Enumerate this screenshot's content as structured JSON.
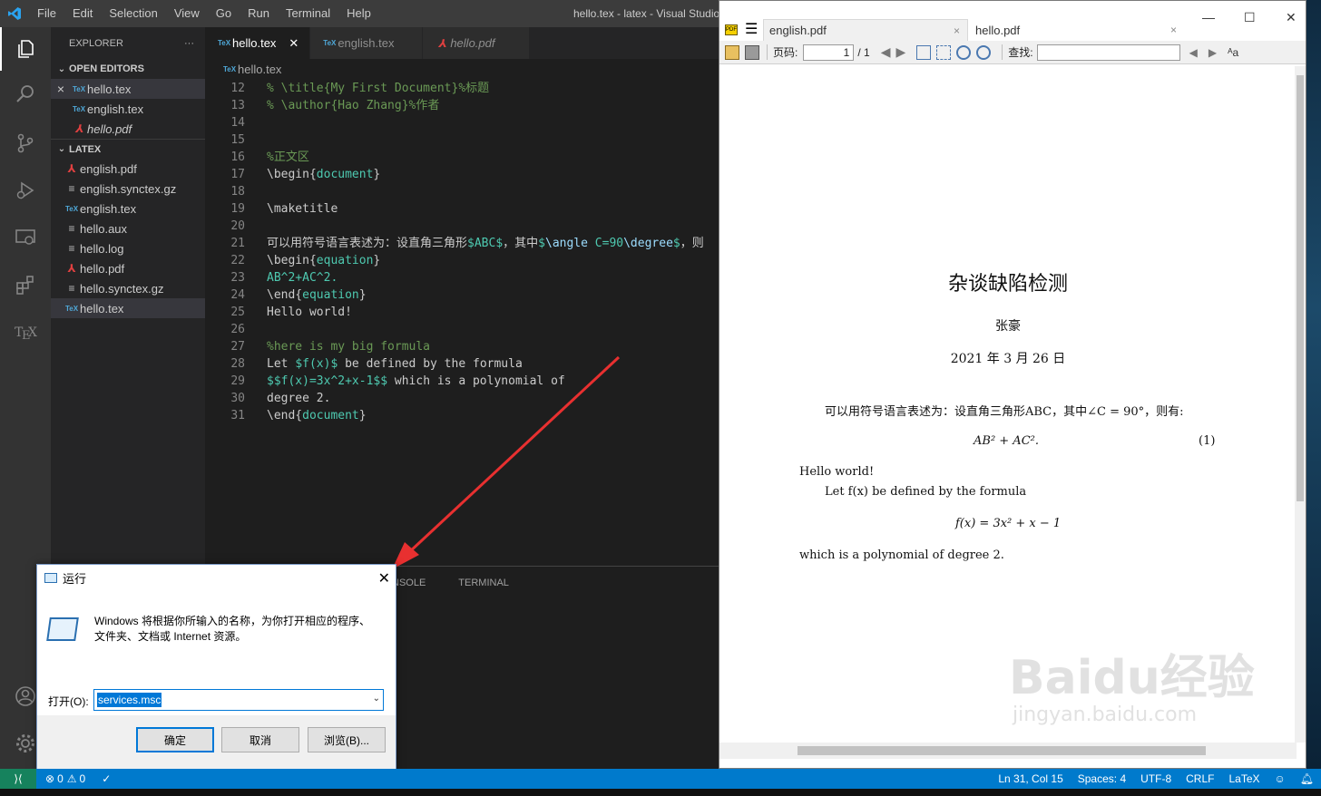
{
  "vscode": {
    "window_title": "hello.tex - latex - Visual Studio Code",
    "menu": [
      "File",
      "Edit",
      "Selection",
      "View",
      "Go",
      "Run",
      "Terminal",
      "Help"
    ],
    "explorer": {
      "header": "EXPLORER",
      "more": "···",
      "open_editors_title": "OPEN EDITORS",
      "open_editors": [
        {
          "name": "hello.tex",
          "type": "tex"
        },
        {
          "name": "english.tex",
          "type": "tex"
        },
        {
          "name": "hello.pdf",
          "type": "pdf"
        }
      ],
      "folder_title": "LATEX",
      "files": [
        {
          "name": "english.pdf",
          "type": "pdf"
        },
        {
          "name": "english.synctex.gz",
          "type": "txt"
        },
        {
          "name": "english.tex",
          "type": "tex"
        },
        {
          "name": "hello.aux",
          "type": "txt"
        },
        {
          "name": "hello.log",
          "type": "txt"
        },
        {
          "name": "hello.pdf",
          "type": "pdf"
        },
        {
          "name": "hello.synctex.gz",
          "type": "txt"
        },
        {
          "name": "hello.tex",
          "type": "tex"
        }
      ]
    },
    "tabs": [
      {
        "label": "hello.tex",
        "active": true
      },
      {
        "label": "english.tex",
        "active": false
      },
      {
        "label": "hello.pdf",
        "active": false
      }
    ],
    "breadcrumb": "hello.tex",
    "code_lines": [
      {
        "n": "12",
        "text": "% \\title{My First Document}%标题"
      },
      {
        "n": "13",
        "text": "% \\author{Hao Zhang}%作者"
      },
      {
        "n": "14",
        "text": ""
      },
      {
        "n": "15",
        "text": ""
      },
      {
        "n": "16",
        "text": "%正文区"
      },
      {
        "n": "17",
        "text": "\\begin{document}"
      },
      {
        "n": "18",
        "text": ""
      },
      {
        "n": "19",
        "text": "\\maketitle"
      },
      {
        "n": "20",
        "text": ""
      },
      {
        "n": "21",
        "text": "可以用符号语言表述为：设直角三角形$ABC$，其中$\\angle C=90\\degree$，则"
      },
      {
        "n": "22",
        "text": "\\begin{equation}"
      },
      {
        "n": "23",
        "text": "AB^2+AC^2."
      },
      {
        "n": "24",
        "text": "\\end{equation}"
      },
      {
        "n": "25",
        "text": "Hello world!"
      },
      {
        "n": "26",
        "text": ""
      },
      {
        "n": "27",
        "text": "%here is my big formula"
      },
      {
        "n": "28",
        "text": "Let $f(x)$ be defined by the formula"
      },
      {
        "n": "29",
        "text": "$$f(x)=3x^2+x-1$$ which is a polynomial of"
      },
      {
        "n": "30",
        "text": "degree 2."
      },
      {
        "n": "31",
        "text": "\\end{document}"
      }
    ],
    "panel_tabs": [
      "NSOLE",
      "TERMINAL"
    ],
    "status": {
      "errors": "0",
      "warnings": "0",
      "position": "Ln 31, Col 15",
      "spaces": "Spaces: 4",
      "encoding": "UTF-8",
      "eol": "CRLF",
      "language": "LaTeX"
    }
  },
  "pdf_viewer": {
    "tabs": [
      {
        "label": "english.pdf",
        "close": "×"
      },
      {
        "label": "hello.pdf",
        "close": "×"
      }
    ],
    "page_label": "页码:",
    "page_current": "1",
    "page_total": "/ 1",
    "find_label": "查找:",
    "document": {
      "title": "杂谈缺陷检测",
      "author": "张豪",
      "date": "2021 年 3 月 26 日",
      "para1": "可以用符号语言表述为：设直角三角形ABC，其中∠C = 90°，则有:",
      "equation": "AB² + AC².",
      "eq_number": "(1)",
      "hello": "Hello world!",
      "let_line": "Let f(x) be defined by the formula",
      "formula": "f(x) = 3x² + x − 1",
      "last_line": "which is a polynomial of degree 2."
    }
  },
  "run_dialog": {
    "title": "运行",
    "description_line1": "Windows 将根据你所输入的名称，为你打开相应的程序、",
    "description_line2": "文件夹、文档或 Internet 资源。",
    "open_label": "打开(O):",
    "input_value": "services.msc",
    "ok": "确定",
    "cancel": "取消",
    "browse": "浏览(B)..."
  },
  "watermark": {
    "text": "Baidu经验",
    "sub": "jingyan.baidu.com"
  },
  "colors": {
    "accent": "#007acc",
    "annotation_arrow": "#e83030"
  }
}
